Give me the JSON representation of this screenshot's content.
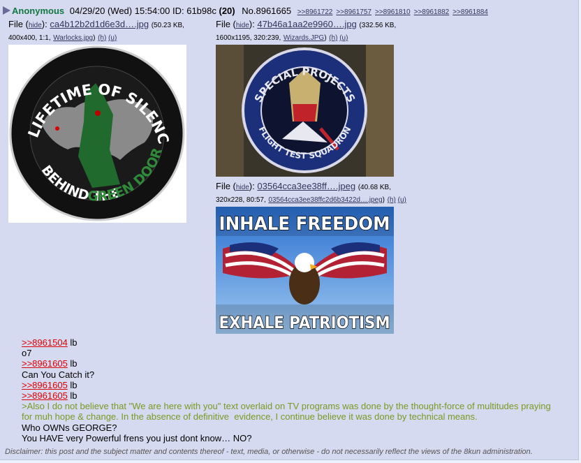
{
  "post": {
    "name": "Anonymous",
    "date": "04/29/20 (Wed) 15:54:00",
    "id_label": "ID:",
    "id": "61b98c",
    "id_count": "(20)",
    "post_no": "No.8961665",
    "backlinks": [
      ">>8961722",
      ">>8961757",
      ">>8961810",
      ">>8961882",
      ">>8961884"
    ]
  },
  "files": [
    {
      "label": "File (",
      "hide": "hide",
      "close": "):",
      "filename": "ca4b12b2d1d6e3d….jpg",
      "size": "(50.23 KB,",
      "meta": "400x400, 1:1,",
      "orig": "Warlocks.jpg",
      "h": "(h)",
      "u": "(u)"
    },
    {
      "label": "File (",
      "hide": "hide",
      "close": "):",
      "filename": "47b46a1aa2e9960….jpg",
      "size": "(332.56 KB,",
      "meta": "1600x1195, 320:239,",
      "orig": "Wizards.JPG",
      "h": "(h)",
      "u": "(u)"
    },
    {
      "label": "File (",
      "hide": "hide",
      "close": "):",
      "filename": "03564cca3ee38ff….jpeg",
      "size": "(40.68 KB,",
      "meta": "320x228, 80:57,",
      "orig": "03564cca3ee38ffc2d6b3422d….jpeg",
      "h": "(h)",
      "u": "(u)"
    }
  ],
  "patch1": {
    "top_text": "A LIFETIME OF SILENCE",
    "bottom_text": "BEHIND THE",
    "green_text": "GREEN DOOR"
  },
  "patch2": {
    "top_text": "SPECIAL PROJECTS",
    "bottom_text": "FLIGHT TEST SQUADRON"
  },
  "eagle": {
    "top_text": "INHALE FREEDOM",
    "bottom_text": "EXHALE PATRIOTISM"
  },
  "body": [
    {
      "link": ">>8961504",
      "text": " lb"
    },
    {
      "text": "o7"
    },
    {
      "link": ">>8961605",
      "text": " lb"
    },
    {
      "text": "Can You Catch it?"
    },
    {
      "link": ">>8961605",
      "text": " lb"
    },
    {
      "link": ">>8961605",
      "text": " lb"
    },
    {
      "green": ">Also I do not believe that \"We are here with you\" text overlaid on TV programs was done by the thought-force of multitudes praying for muh hope & change. In the absence of definitive  evidence, I continue believe it was done by technical means."
    },
    {
      "text": "Who OWNs GEORGE?"
    },
    {
      "text": "You HAVE very Powerful frens you just dont know… NO?"
    }
  ],
  "disclaimer": "Disclaimer: this post and the subject matter and contents thereof - text, media, or otherwise - do not necessarily reflect the views of the 8kun administration.",
  "colors": {
    "post_bg": "#d6daf0",
    "page_bg": "#eef2ff",
    "name": "#117743",
    "quotelink": "#dd0000",
    "greentext": "#789922"
  }
}
